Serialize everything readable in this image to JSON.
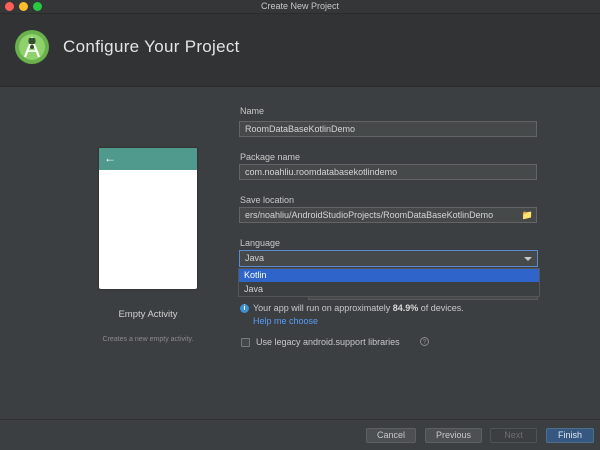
{
  "window": {
    "title": "Create New Project"
  },
  "header": {
    "title": "Configure Your Project"
  },
  "template": {
    "name": "Empty Activity",
    "description": "Creates a new empty activity.",
    "back_arrow": "←"
  },
  "form": {
    "name_label": "Name",
    "name_value": "RoomDataBaseKotlinDemo",
    "package_label": "Package name",
    "package_value": "com.noahliu.roomdatabasekotlindemo",
    "location_label": "Save location",
    "location_value": "ers/noahliu/AndroidStudioProjects/RoomDataBaseKotlinDemo",
    "folder_icon": "📁",
    "language_label": "Language",
    "language_value": "Java",
    "language_options": [
      "Kotlin",
      "Java"
    ]
  },
  "info": {
    "icon": "i",
    "prefix": "Your app will run on approximately ",
    "percent": "84.9%",
    "suffix": " of devices.",
    "help_link": "Help me choose"
  },
  "legacy": {
    "label": "Use legacy android.support libraries",
    "help_icon": "?",
    "checked": false
  },
  "footer": {
    "cancel": "Cancel",
    "previous": "Previous",
    "next": "Next",
    "finish": "Finish"
  },
  "colors": {
    "accent": "#365880",
    "selection": "#2f65ca",
    "link": "#589df6",
    "phone_bar": "#4f9a8c"
  }
}
